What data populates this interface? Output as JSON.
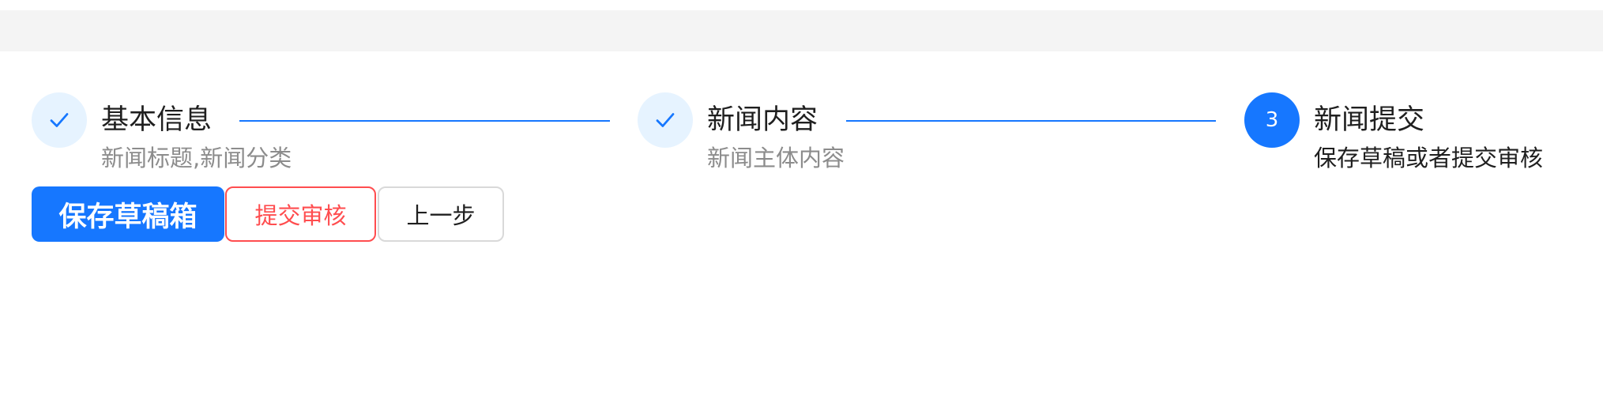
{
  "steps": [
    {
      "title": "基本信息",
      "description": "新闻标题,新闻分类",
      "status": "finished",
      "icon": "check-icon"
    },
    {
      "title": "新闻内容",
      "description": "新闻主体内容",
      "status": "finished",
      "icon": "check-icon"
    },
    {
      "title": "新闻提交",
      "description": "保存草稿或者提交审核",
      "status": "active",
      "number": "3"
    }
  ],
  "actions": {
    "save_draft_label": "保存草稿箱",
    "submit_review_label": "提交审核",
    "previous_label": "上一步"
  },
  "colors": {
    "primary": "#1677ff",
    "danger": "#ff4d4f",
    "done_icon_bg": "#e6f3ff",
    "page_bg": "#f4f4f4"
  }
}
